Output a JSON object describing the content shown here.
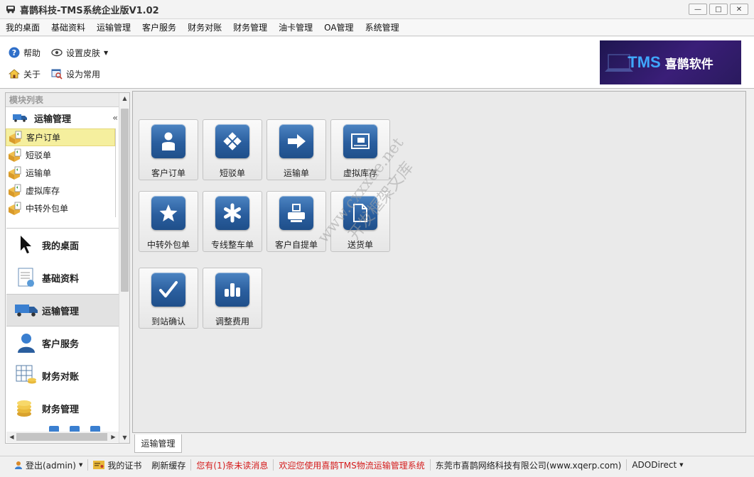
{
  "window": {
    "title": "喜鹊科技-TMS系统企业版V1.02",
    "controls": [
      "—",
      "□",
      "✕"
    ]
  },
  "menu": [
    "我的桌面",
    "基础资料",
    "运输管理",
    "客户服务",
    "财务对账",
    "财务管理",
    "油卡管理",
    "OA管理",
    "系统管理"
  ],
  "toolbar": {
    "help": "帮助",
    "skin": "设置皮肤",
    "about": "关于",
    "set_common": "设为常用"
  },
  "logo": {
    "tms": "TMS",
    "name": "喜鹊软件"
  },
  "left_panel": {
    "header": "模块列表",
    "module_title": "运输管理",
    "collapse": "«",
    "sub_items": [
      "客户订单",
      "短驳单",
      "运输单",
      "虚拟库存",
      "中转外包单"
    ],
    "nav": [
      "我的桌面",
      "基础资料",
      "运输管理",
      "客户服务",
      "财务对账",
      "财务管理"
    ]
  },
  "tiles": [
    {
      "label": "客户订单",
      "icon": "person-icon"
    },
    {
      "label": "短驳单",
      "icon": "diamond-grid-icon"
    },
    {
      "label": "运输单",
      "icon": "arrow-right-icon"
    },
    {
      "label": "虚拟库存",
      "icon": "box-card-icon"
    },
    {
      "label": "中转外包单",
      "icon": "star-icon"
    },
    {
      "label": "专线整车单",
      "icon": "asterisk-icon"
    },
    {
      "label": "客户自提单",
      "icon": "printer-icon"
    },
    {
      "label": "送货单",
      "icon": "document-icon"
    },
    {
      "label": "到站确认",
      "icon": "checkmark-icon"
    },
    {
      "label": "调整费用",
      "icon": "bar-chart-icon"
    }
  ],
  "tab": "运输管理",
  "watermark": {
    "line1": "www.cxxxde.net",
    "line2": "开发框架文库"
  },
  "status": {
    "logout": "登出(admin)",
    "cert": "我的证书",
    "refresh": "刷新缓存",
    "unread": "您有(1)条未读消息",
    "welcome": "欢迎您使用喜鹊TMS物流运输管理系统",
    "company": "东莞市喜鹊网络科技有限公司(www.xqerp.com)",
    "db": "ADODirect"
  },
  "colors": {
    "tile_blue": "#2a5e9e",
    "selected_item": "#f5ef9e",
    "status_red": "#d41c1c"
  }
}
